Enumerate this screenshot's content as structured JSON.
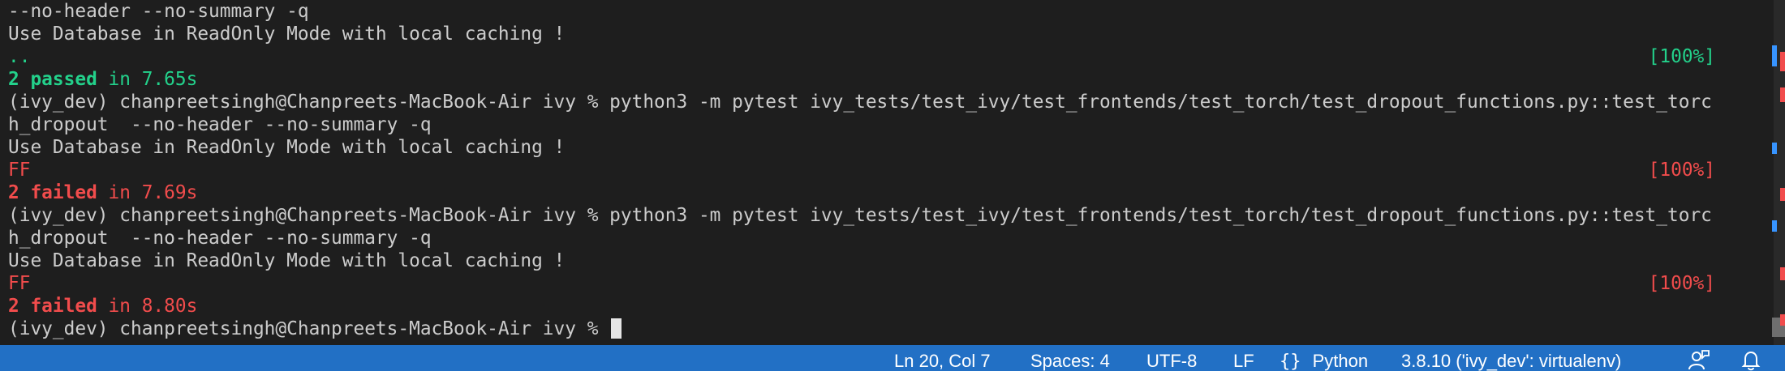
{
  "terminal": {
    "lines": [
      {
        "text": "--no-header --no-summary -q"
      },
      {
        "text": "Use Database in ReadOnly Mode with local caching !"
      },
      {
        "text": "..",
        "right": "[100%]"
      },
      {
        "bold": "2 passed",
        "rest": " in 7.65s"
      },
      {
        "text": "(ivy_dev) chanpreetsingh@Chanpreets-MacBook-Air ivy % python3 -m pytest ivy_tests/test_ivy/test_frontends/test_torch/test_dropout_functions.py::test_torc"
      },
      {
        "text": "h_dropout  --no-header --no-summary -q"
      },
      {
        "text": "Use Database in ReadOnly Mode with local caching !"
      },
      {
        "text": "FF",
        "right": "[100%]"
      },
      {
        "bold": "2 failed",
        "rest": " in 7.69s"
      },
      {
        "text": "(ivy_dev) chanpreetsingh@Chanpreets-MacBook-Air ivy % python3 -m pytest ivy_tests/test_ivy/test_frontends/test_torch/test_dropout_functions.py::test_torc"
      },
      {
        "text": "h_dropout  --no-header --no-summary -q"
      },
      {
        "text": "Use Database in ReadOnly Mode with local caching !"
      },
      {
        "text": "FF",
        "right": "[100%]"
      },
      {
        "bold": "2 failed",
        "rest": " in 8.80s"
      },
      {
        "text": "(ivy_dev) chanpreetsingh@Chanpreets-MacBook-Air ivy % "
      }
    ]
  },
  "statusbar": {
    "position": "Ln 20, Col 7",
    "spaces": "Spaces: 4",
    "encoding": "UTF-8",
    "eol": "LF",
    "language": "Python",
    "interpreter": "3.8.10 ('ivy_dev': virtualenv)"
  },
  "icons": {
    "language": "braces-icon",
    "feedback": "feedback-person-icon",
    "notifications": "bell-icon"
  },
  "colors": {
    "background": "#1e1e1e",
    "text": "#cccccc",
    "pass": "#23d18b",
    "fail": "#f14c4c",
    "statusbar": "#2270c5"
  }
}
